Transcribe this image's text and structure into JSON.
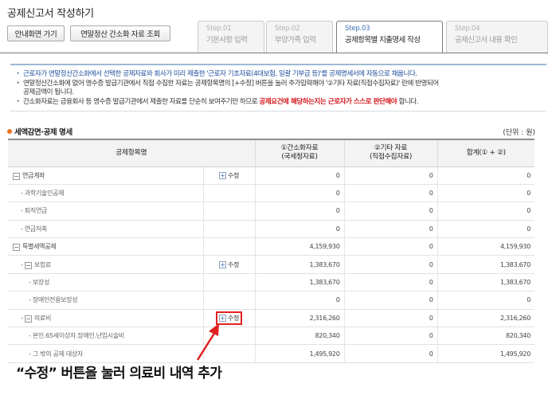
{
  "header": {
    "title": "공제신고서 작성하기",
    "btn_home": "안내화면 가기",
    "btn_simple": "연말정산 간소화 자료 조회"
  },
  "steps": [
    {
      "num": "Step.01",
      "name": "기본사항 입력",
      "active": false
    },
    {
      "num": "Step.02",
      "name": "부양가족 입력",
      "active": false
    },
    {
      "num": "Step.03",
      "name": "공제항목별 지출명세 작성",
      "active": true
    },
    {
      "num": "Step.04",
      "name": "공제신고서 내용 확인",
      "active": false
    }
  ],
  "notices": {
    "n1": "근로자가 연말정산간소화에서 선택한 공제자료와 회사가 미리 제출한 '근로자 기초자료(4대보험, 일괄 기부금 등)'를 공제명세서에 자동으로 채웁니다.",
    "n2a": "연말정산간소화에 없어 영수증 발급기관에서 직접 수집한 자료는 공제항목명의 [+수정] 버튼을 눌러 추가입력해야 '②기타 자료(직접수집자료)' 란에 반영되어",
    "n2b": "공제금액이 됩니다.",
    "n3a": "간소화자료는 금융회사 등 영수증 발급기관에서 제출한 자료를 단순히 보여주기만 하므로 ",
    "n3b": "공제요건에 해당하는지는 근로자가 스스로 판단해야",
    "n3c": " 합니다."
  },
  "section": {
    "title": "세액감면·공제 명세",
    "unit": "(단위 : 원)"
  },
  "table": {
    "headers": {
      "item": "공제항목명",
      "simple_l1": "①간소화자료",
      "simple_l2": "(국세청자료)",
      "other_l1": "②기타 자료",
      "other_l2": "(직접수집자료)",
      "total": "합계(① + ②)"
    },
    "edit_label": "수정",
    "rows": [
      {
        "name": "연금계좌",
        "simple": "0",
        "other": "0",
        "total": "0"
      },
      {
        "name": "과학기술인공제",
        "simple": "0",
        "other": "0",
        "total": "0"
      },
      {
        "name": "퇴직연금",
        "simple": "0",
        "other": "0",
        "total": "0"
      },
      {
        "name": "연금저축",
        "simple": "0",
        "other": "0",
        "total": "0"
      },
      {
        "name": "특별세액공제",
        "simple": "4,159,930",
        "other": "0",
        "total": "4,159,930"
      },
      {
        "name": "보험료",
        "simple": "1,383,670",
        "other": "0",
        "total": "1,383,670"
      },
      {
        "name": "보장성",
        "simple": "1,383,670",
        "other": "0",
        "total": "1,383,670"
      },
      {
        "name": "장애인전용보장성",
        "simple": "0",
        "other": "0",
        "total": "0"
      },
      {
        "name": "의료비",
        "simple": "2,316,260",
        "other": "0",
        "total": "2,316,260"
      },
      {
        "name": "본인.65세이상자.장애인.난임시술비",
        "simple": "820,340",
        "other": "0",
        "total": "820,340"
      },
      {
        "name": "그 밖의 공제 대상자",
        "simple": "1,495,920",
        "other": "0",
        "total": "1,495,920"
      }
    ]
  },
  "annotation": {
    "caption": "“수정” 버튼을 눌러 의료비 내역 추가",
    "color": "#e12020"
  }
}
